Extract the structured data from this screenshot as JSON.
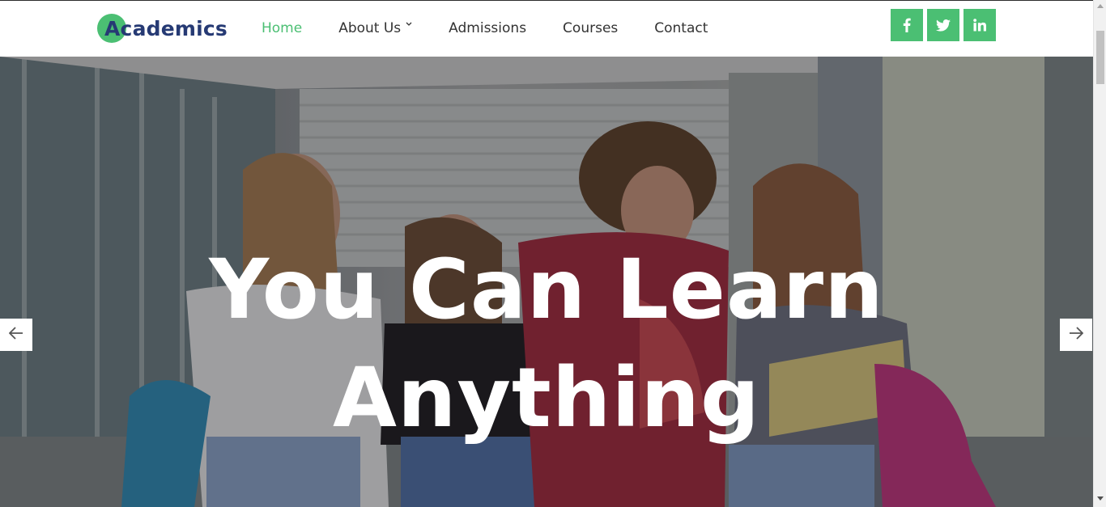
{
  "brand": {
    "name": "Academics"
  },
  "nav": {
    "items": [
      {
        "label": "Home",
        "active": true
      },
      {
        "label": "About Us",
        "has_dropdown": true
      },
      {
        "label": "Admissions"
      },
      {
        "label": "Courses"
      },
      {
        "label": "Contact"
      }
    ]
  },
  "social": [
    {
      "name": "facebook-icon",
      "glyph": "f"
    },
    {
      "name": "twitter-icon",
      "glyph": "twitter"
    },
    {
      "name": "linkedin-icon",
      "glyph": "in"
    }
  ],
  "hero": {
    "title_line1": "You Can Learn",
    "title_line2": "Anything"
  },
  "colors": {
    "accent": "#4bbf73",
    "brand_text": "#263a74",
    "nav_text": "#333333"
  }
}
